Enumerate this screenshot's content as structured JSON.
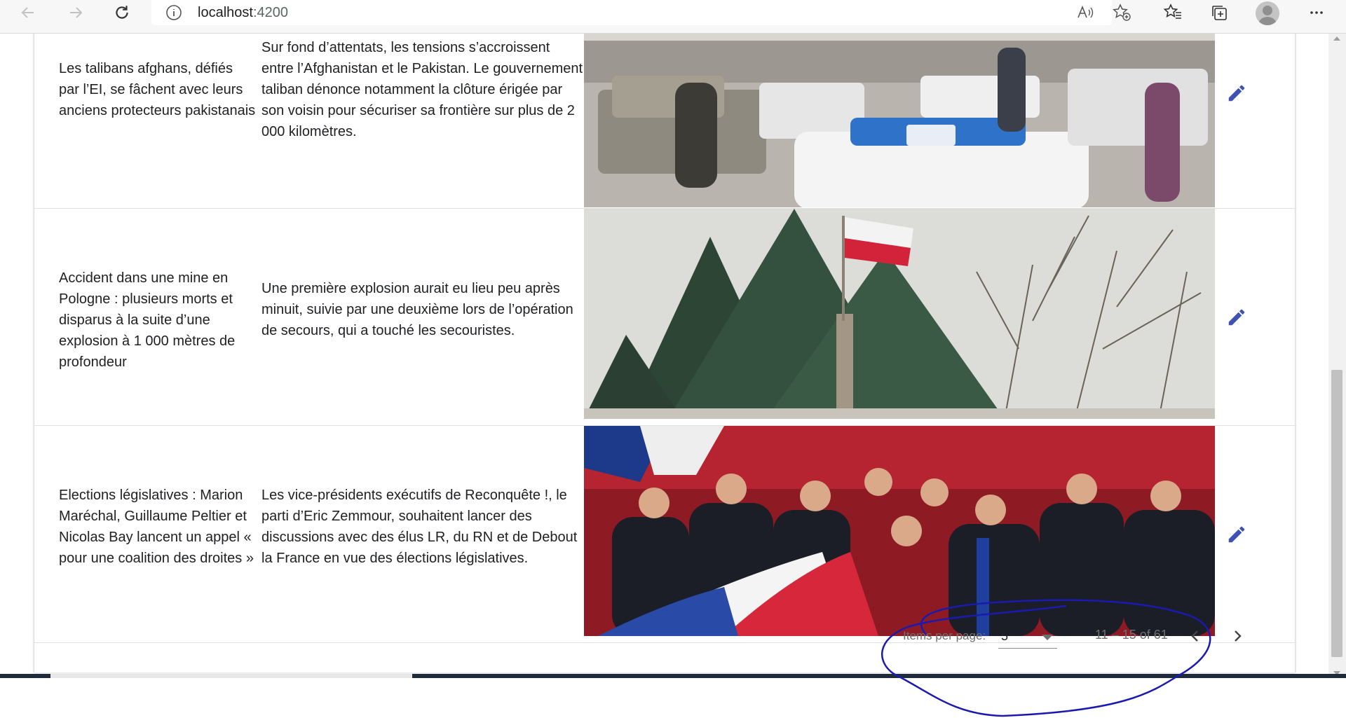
{
  "browser": {
    "address": "localhost",
    "port": ":4200",
    "icons": [
      "back-arrow-icon",
      "forward-arrow-icon",
      "refresh-icon",
      "info-icon",
      "read-aloud-icon",
      "add-favorite-icon",
      "favorites-icon",
      "collections-icon",
      "profile-avatar",
      "more-options-icon"
    ]
  },
  "articles": [
    {
      "title": "Les talibans afghans, défiés par l’EI, se fâchent avec leurs anciens protecteurs pakistanais",
      "description": "Sur fond d’attentats, les tensions s’accroissent entre l’Afghanistan et le Pakistan. Le gouvernement taliban dénonce notamment la clôture érigée par son voisin pour sécuriser sa frontière sur plus de 2 000 kilomètres.",
      "image_alt": "Taliban fighters next to vehicles in a street"
    },
    {
      "title": "Accident dans une mine en Pologne : plusieurs morts et disparus à la suite d’une explosion à 1 000 mètres de profondeur",
      "description": "Une première explosion aurait eu lieu peu après minuit, suivie par une deuxième lors de l’opération de secours, qui a touché les secouristes.",
      "image_alt": "Polish flag on a wooden pole in front of trees"
    },
    {
      "title": "Elections législatives : Marion Maréchal, Guillaume Peltier et Nicolas Bay lancent un appel « pour une coalition des droites »",
      "description": "Les vice-présidents exécutifs de Reconquête !, le parti d’Eric Zemmour, souhaitent lancer des discussions avec des élus LR, du RN et de Debout la France en vue des élections législatives.",
      "image_alt": "Crowd of politicians singing with French flags"
    }
  ],
  "paginator": {
    "items_per_page_label": "Items per page:",
    "page_size": "5",
    "range_label": "11 – 15 of 61"
  },
  "colors": {
    "edit_icon": "#3f51b5",
    "annotation_ink": "#1a1ab0",
    "paginator_text": "#6f6f6f"
  }
}
